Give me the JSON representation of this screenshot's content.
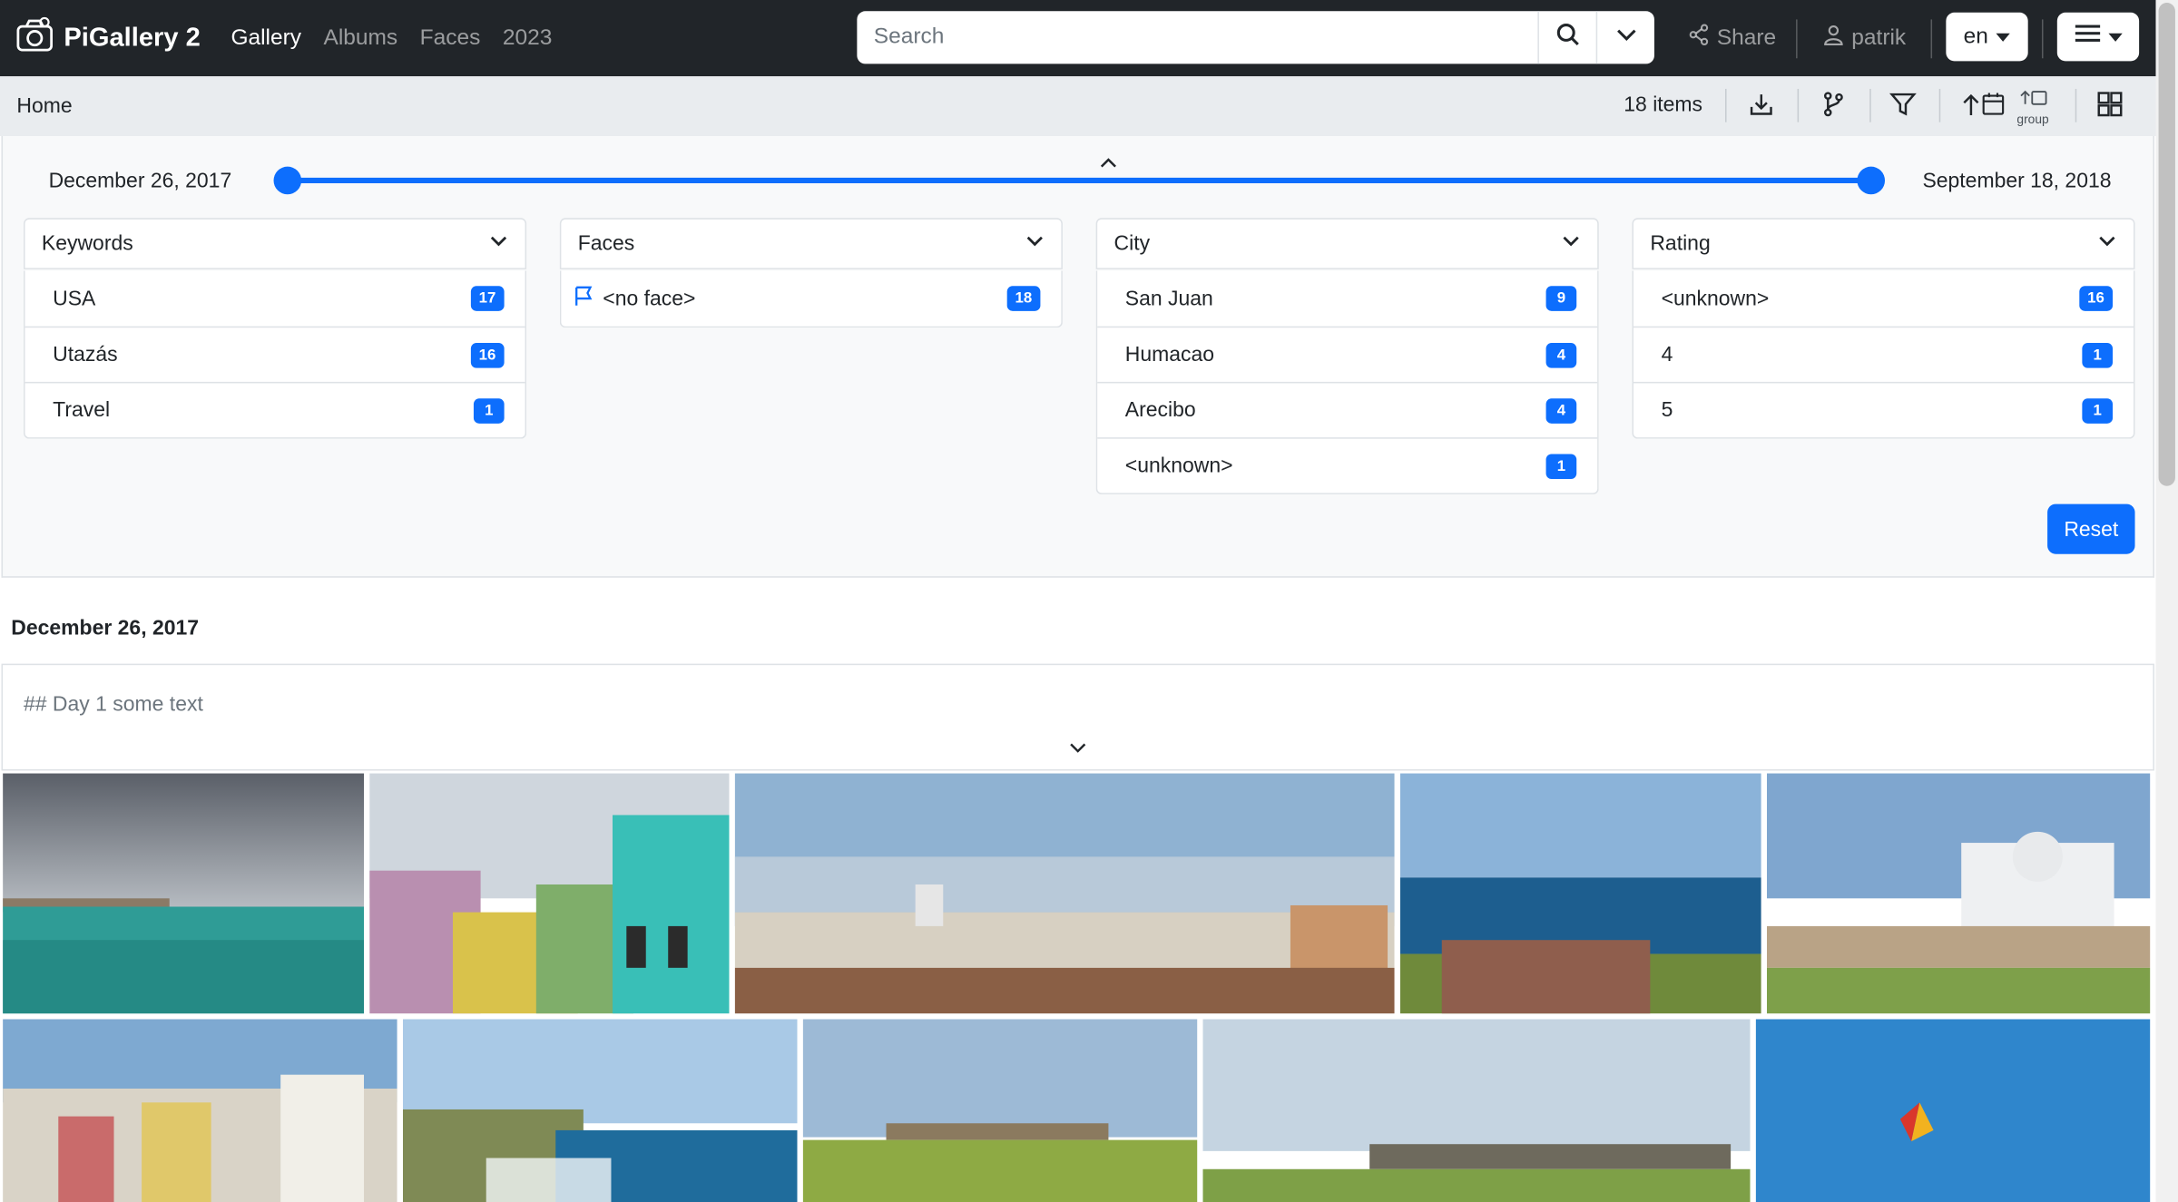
{
  "app": {
    "name": "PiGallery 2"
  },
  "nav": {
    "items": [
      {
        "label": "Gallery"
      },
      {
        "label": "Albums"
      },
      {
        "label": "Faces"
      },
      {
        "label": "2023"
      }
    ]
  },
  "search": {
    "placeholder": "Search"
  },
  "header": {
    "share_label": "Share",
    "user_name": "patrik",
    "language": "en"
  },
  "toolbar": {
    "breadcrumb": "Home",
    "items_count": "18 items",
    "group_label": "group"
  },
  "filters": {
    "date_from": "December 26, 2017",
    "date_to": "September 18, 2018",
    "cards": [
      {
        "title": "Keywords",
        "items": [
          {
            "label": "USA",
            "count": "17"
          },
          {
            "label": "Utazás",
            "count": "16"
          },
          {
            "label": "Travel",
            "count": "1"
          }
        ]
      },
      {
        "title": "Faces",
        "items": [
          {
            "label": "<no face>",
            "count": "18"
          }
        ]
      },
      {
        "title": "City",
        "items": [
          {
            "label": "San Juan",
            "count": "9"
          },
          {
            "label": "Humacao",
            "count": "4"
          },
          {
            "label": "Arecibo",
            "count": "4"
          },
          {
            "label": "<unknown>",
            "count": "1"
          }
        ]
      },
      {
        "title": "Rating",
        "items": [
          {
            "label": "<unknown>",
            "count": "16"
          },
          {
            "label": "4",
            "count": "1"
          },
          {
            "label": "5",
            "count": "1"
          }
        ]
      }
    ],
    "reset_label": "Reset"
  },
  "content": {
    "day_title": "December 26, 2017",
    "description": "## Day 1 some text"
  },
  "colors": {
    "navbar": "#212529",
    "accent": "#0d6efd",
    "subbar": "#e9ecef"
  },
  "icons": [
    "camera-logo-icon",
    "search-icon",
    "chevron-down-icon",
    "share-icon",
    "user-icon",
    "download-icon",
    "branch-icon",
    "filter-icon",
    "sort-arrow-up-icon",
    "calendar-icon",
    "grid-icon",
    "chevron-up-icon",
    "flag-icon",
    "menu-icon"
  ]
}
